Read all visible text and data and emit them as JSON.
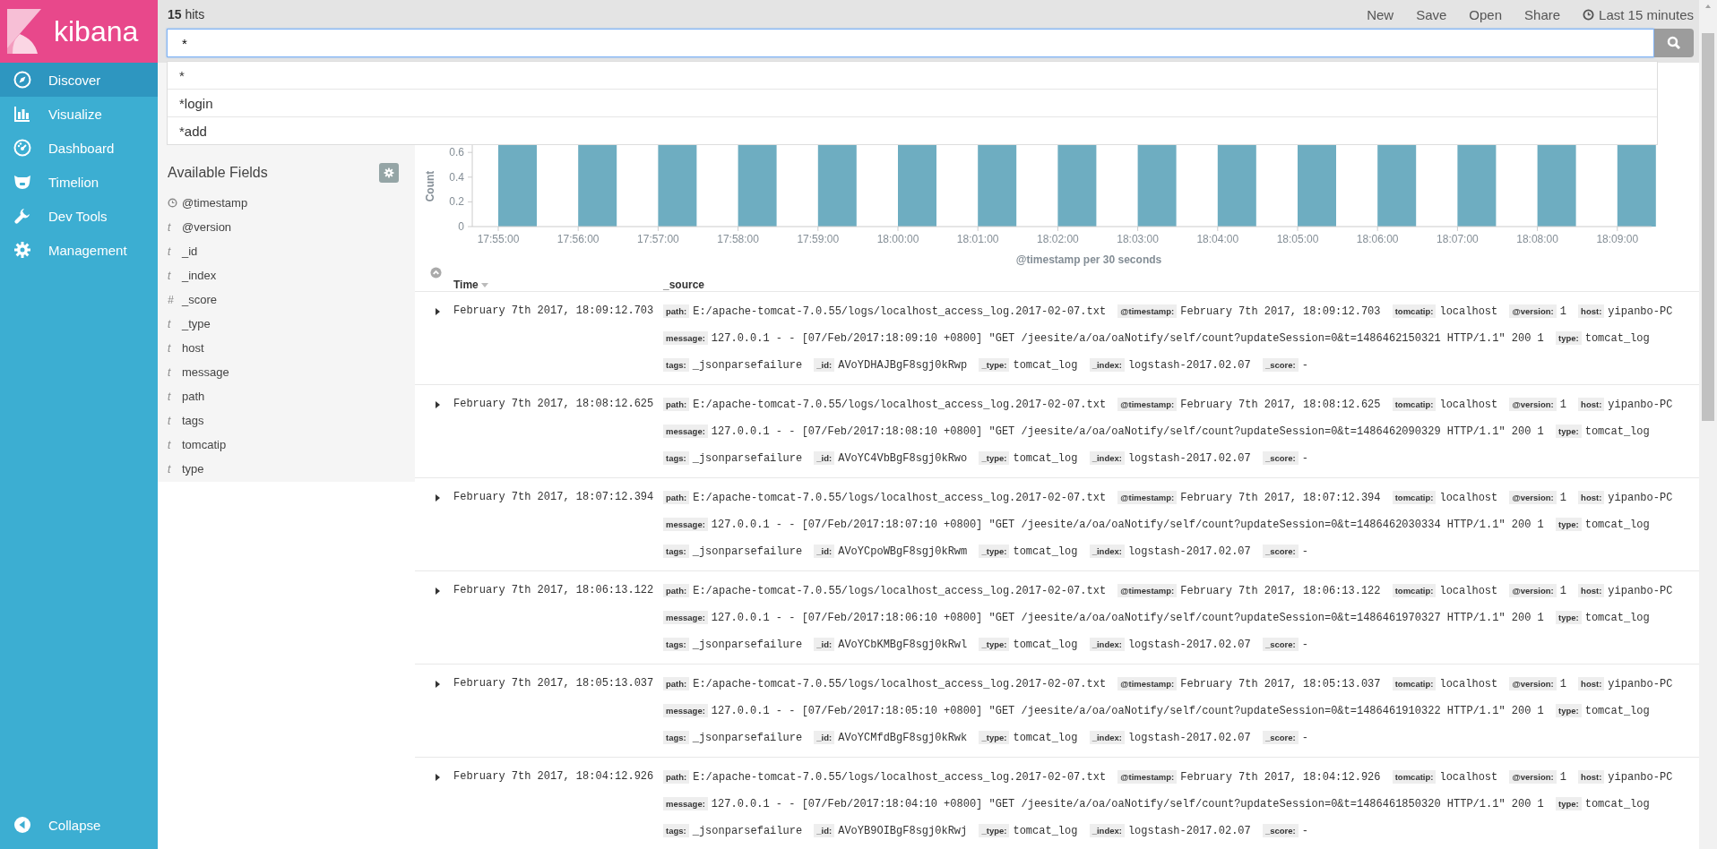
{
  "sidebar": {
    "logo": "kibana",
    "items": [
      {
        "label": "Discover",
        "selected": true
      },
      {
        "label": "Visualize",
        "selected": false
      },
      {
        "label": "Dashboard",
        "selected": false
      },
      {
        "label": "Timelion",
        "selected": false
      },
      {
        "label": "Dev Tools",
        "selected": false
      },
      {
        "label": "Management",
        "selected": false
      }
    ],
    "collapse": "Collapse"
  },
  "top_bar": {
    "hits": "**15** hits",
    "actions": [
      "New",
      "Save",
      "Open",
      "Share"
    ],
    "time_range": "Last 15 minutes"
  },
  "search": {
    "value": "*",
    "suggestions": [
      "*",
      "*login",
      "*add"
    ]
  },
  "fields_panel": {
    "title": "Available Fields",
    "fields": [
      {
        "kind": "date",
        "name": "@timestamp"
      },
      {
        "kind": "typed",
        "glyph": "t",
        "name": "@version"
      },
      {
        "kind": "typed",
        "glyph": "t",
        "name": "_id"
      },
      {
        "kind": "typed",
        "glyph": "t",
        "name": "_index"
      },
      {
        "kind": "typed",
        "glyph": "#",
        "name": "_score"
      },
      {
        "kind": "typed",
        "glyph": "t",
        "name": "_type"
      },
      {
        "kind": "typed",
        "glyph": "t",
        "name": "host"
      },
      {
        "kind": "typed",
        "glyph": "t",
        "name": "message"
      },
      {
        "kind": "typed",
        "glyph": "t",
        "name": "path"
      },
      {
        "kind": "typed",
        "glyph": "t",
        "name": "tags"
      },
      {
        "kind": "typed",
        "glyph": "t",
        "name": "tomcatip"
      },
      {
        "kind": "typed",
        "glyph": "t",
        "name": "type"
      }
    ]
  },
  "histogram": {
    "xlabel": "@timestamp per 30 seconds",
    "ylabel": "Count",
    "x_ticks": [
      "17:55:00",
      "17:56:00",
      "17:57:00",
      "17:58:00",
      "17:59:00",
      "18:00:00",
      "18:01:00",
      "18:02:00",
      "18:03:00",
      "18:04:00",
      "18:05:00",
      "18:06:00",
      "18:07:00",
      "18:08:00",
      "18:09:00"
    ],
    "y_ticks": [
      "0.6",
      "0.4",
      "0.2",
      "0"
    ]
  },
  "table": {
    "columns": [
      "Time",
      "_source"
    ],
    "rows": [
      {
        "time": "February 7th 2017, 18:09:12.703",
        "source": [
          {
            "key": "path:",
            "value": "E:/apache-tomcat-7.0.55/logs/localhost_access_log.2017-02-07.txt"
          },
          {
            "key": "@timestamp:",
            "value": "February 7th 2017, 18:09:12.703"
          },
          {
            "key": "tomcatip:",
            "value": "localhost"
          },
          {
            "key": "@version:",
            "value": "1"
          },
          {
            "key": "host:",
            "value": "yipanbo-PC"
          },
          {
            "key": "message:",
            "value": "127.0.0.1 - - [07/Feb/2017:18:09:10 +0800] \"GET /jeesite/a/oa/oaNotify/self/count?updateSession=0&t=1486462150321 HTTP/1.1\" 200 1"
          },
          {
            "key": "type:",
            "value": "tomcat_log"
          },
          {
            "key": "tags:",
            "value": "_jsonparsefailure"
          },
          {
            "key": "_id:",
            "value": "AVoYDHAJBgF8sgj0kRwp"
          },
          {
            "key": "_type:",
            "value": "tomcat_log"
          },
          {
            "key": "_index:",
            "value": "logstash-2017.02.07"
          },
          {
            "key": "_score:",
            "value": "-"
          }
        ]
      },
      {
        "time": "February 7th 2017, 18:08:12.625",
        "source": [
          {
            "key": "path:",
            "value": "E:/apache-tomcat-7.0.55/logs/localhost_access_log.2017-02-07.txt"
          },
          {
            "key": "@timestamp:",
            "value": "February 7th 2017, 18:08:12.625"
          },
          {
            "key": "tomcatip:",
            "value": "localhost"
          },
          {
            "key": "@version:",
            "value": "1"
          },
          {
            "key": "host:",
            "value": "yipanbo-PC"
          },
          {
            "key": "message:",
            "value": "127.0.0.1 - - [07/Feb/2017:18:08:10 +0800] \"GET /jeesite/a/oa/oaNotify/self/count?updateSession=0&t=1486462090329 HTTP/1.1\" 200 1"
          },
          {
            "key": "type:",
            "value": "tomcat_log"
          },
          {
            "key": "tags:",
            "value": "_jsonparsefailure"
          },
          {
            "key": "_id:",
            "value": "AVoYC4VbBgF8sgj0kRwo"
          },
          {
            "key": "_type:",
            "value": "tomcat_log"
          },
          {
            "key": "_index:",
            "value": "logstash-2017.02.07"
          },
          {
            "key": "_score:",
            "value": "-"
          }
        ]
      },
      {
        "time": "February 7th 2017, 18:07:12.394",
        "source": [
          {
            "key": "path:",
            "value": "E:/apache-tomcat-7.0.55/logs/localhost_access_log.2017-02-07.txt"
          },
          {
            "key": "@timestamp:",
            "value": "February 7th 2017, 18:07:12.394"
          },
          {
            "key": "tomcatip:",
            "value": "localhost"
          },
          {
            "key": "@version:",
            "value": "1"
          },
          {
            "key": "host:",
            "value": "yipanbo-PC"
          },
          {
            "key": "message:",
            "value": "127.0.0.1 - - [07/Feb/2017:18:07:10 +0800] \"GET /jeesite/a/oa/oaNotify/self/count?updateSession=0&t=1486462030334 HTTP/1.1\" 200 1"
          },
          {
            "key": "type:",
            "value": "tomcat_log"
          },
          {
            "key": "tags:",
            "value": "_jsonparsefailure"
          },
          {
            "key": "_id:",
            "value": "AVoYCpoWBgF8sgj0kRwm"
          },
          {
            "key": "_type:",
            "value": "tomcat_log"
          },
          {
            "key": "_index:",
            "value": "logstash-2017.02.07"
          },
          {
            "key": "_score:",
            "value": "-"
          }
        ]
      },
      {
        "time": "February 7th 2017, 18:06:13.122",
        "source": [
          {
            "key": "path:",
            "value": "E:/apache-tomcat-7.0.55/logs/localhost_access_log.2017-02-07.txt"
          },
          {
            "key": "@timestamp:",
            "value": "February 7th 2017, 18:06:13.122"
          },
          {
            "key": "tomcatip:",
            "value": "localhost"
          },
          {
            "key": "@version:",
            "value": "1"
          },
          {
            "key": "host:",
            "value": "yipanbo-PC"
          },
          {
            "key": "message:",
            "value": "127.0.0.1 - - [07/Feb/2017:18:06:10 +0800] \"GET /jeesite/a/oa/oaNotify/self/count?updateSession=0&t=1486461970327 HTTP/1.1\" 200 1"
          },
          {
            "key": "type:",
            "value": "tomcat_log"
          },
          {
            "key": "tags:",
            "value": "_jsonparsefailure"
          },
          {
            "key": "_id:",
            "value": "AVoYCbKMBgF8sgj0kRwl"
          },
          {
            "key": "_type:",
            "value": "tomcat_log"
          },
          {
            "key": "_index:",
            "value": "logstash-2017.02.07"
          },
          {
            "key": "_score:",
            "value": "-"
          }
        ]
      },
      {
        "time": "February 7th 2017, 18:05:13.037",
        "source": [
          {
            "key": "path:",
            "value": "E:/apache-tomcat-7.0.55/logs/localhost_access_log.2017-02-07.txt"
          },
          {
            "key": "@timestamp:",
            "value": "February 7th 2017, 18:05:13.037"
          },
          {
            "key": "tomcatip:",
            "value": "localhost"
          },
          {
            "key": "@version:",
            "value": "1"
          },
          {
            "key": "host:",
            "value": "yipanbo-PC"
          },
          {
            "key": "message:",
            "value": "127.0.0.1 - - [07/Feb/2017:18:05:10 +0800] \"GET /jeesite/a/oa/oaNotify/self/count?updateSession=0&t=1486461910322 HTTP/1.1\" 200 1"
          },
          {
            "key": "type:",
            "value": "tomcat_log"
          },
          {
            "key": "tags:",
            "value": "_jsonparsefailure"
          },
          {
            "key": "_id:",
            "value": "AVoYCMfdBgF8sgj0kRwk"
          },
          {
            "key": "_type:",
            "value": "tomcat_log"
          },
          {
            "key": "_index:",
            "value": "logstash-2017.02.07"
          },
          {
            "key": "_score:",
            "value": "-"
          }
        ]
      },
      {
        "time": "February 7th 2017, 18:04:12.926",
        "source": [
          {
            "key": "path:",
            "value": "E:/apache-tomcat-7.0.55/logs/localhost_access_log.2017-02-07.txt"
          },
          {
            "key": "@timestamp:",
            "value": "February 7th 2017, 18:04:12.926"
          },
          {
            "key": "tomcatip:",
            "value": "localhost"
          },
          {
            "key": "@version:",
            "value": "1"
          },
          {
            "key": "host:",
            "value": "yipanbo-PC"
          },
          {
            "key": "message:",
            "value": "127.0.0.1 - - [07/Feb/2017:18:04:10 +0800] \"GET /jeesite/a/oa/oaNotify/self/count?updateSession=0&t=1486461850320 HTTP/1.1\" 200 1"
          },
          {
            "key": "type:",
            "value": "tomcat_log"
          },
          {
            "key": "tags:",
            "value": "_jsonparsefailure"
          },
          {
            "key": "_id:",
            "value": "AVoYB9OIBgF8sgj0kRwj"
          },
          {
            "key": "_type:",
            "value": "tomcat_log"
          },
          {
            "key": "_index:",
            "value": "logstash-2017.02.07"
          },
          {
            "key": "_score:",
            "value": "-"
          }
        ]
      }
    ]
  }
}
